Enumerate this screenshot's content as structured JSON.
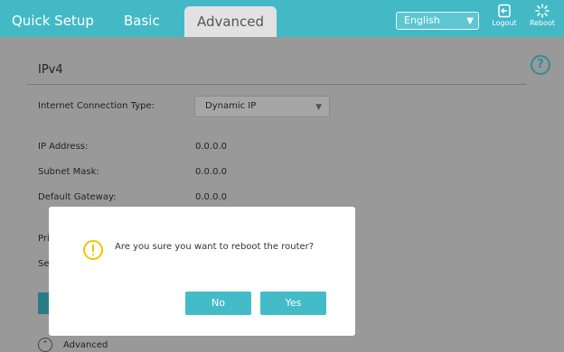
{
  "nav": {
    "tabs": [
      {
        "label": "Quick Setup"
      },
      {
        "label": "Basic"
      },
      {
        "label": "Advanced"
      }
    ],
    "language": "English",
    "logout_label": "Logout",
    "reboot_label": "Reboot"
  },
  "panel": {
    "title": "IPv4",
    "connection_type_label": "Internet Connection Type:",
    "connection_type_value": "Dynamic IP",
    "fields": [
      {
        "label": "IP Address:",
        "value": "0.0.0.0"
      },
      {
        "label": "Subnet Mask:",
        "value": "0.0.0.0"
      },
      {
        "label": "Default Gateway:",
        "value": "0.0.0.0"
      }
    ],
    "partial_label_1": "Pri",
    "partial_label_2": "Se",
    "advanced_label": "Advanced"
  },
  "dialog": {
    "message": "Are you sure you want to reboot the router?",
    "no_label": "No",
    "yes_label": "Yes"
  },
  "colors": {
    "header": "#43b9c6",
    "button": "#43bcc8",
    "warning": "#f5c400"
  }
}
